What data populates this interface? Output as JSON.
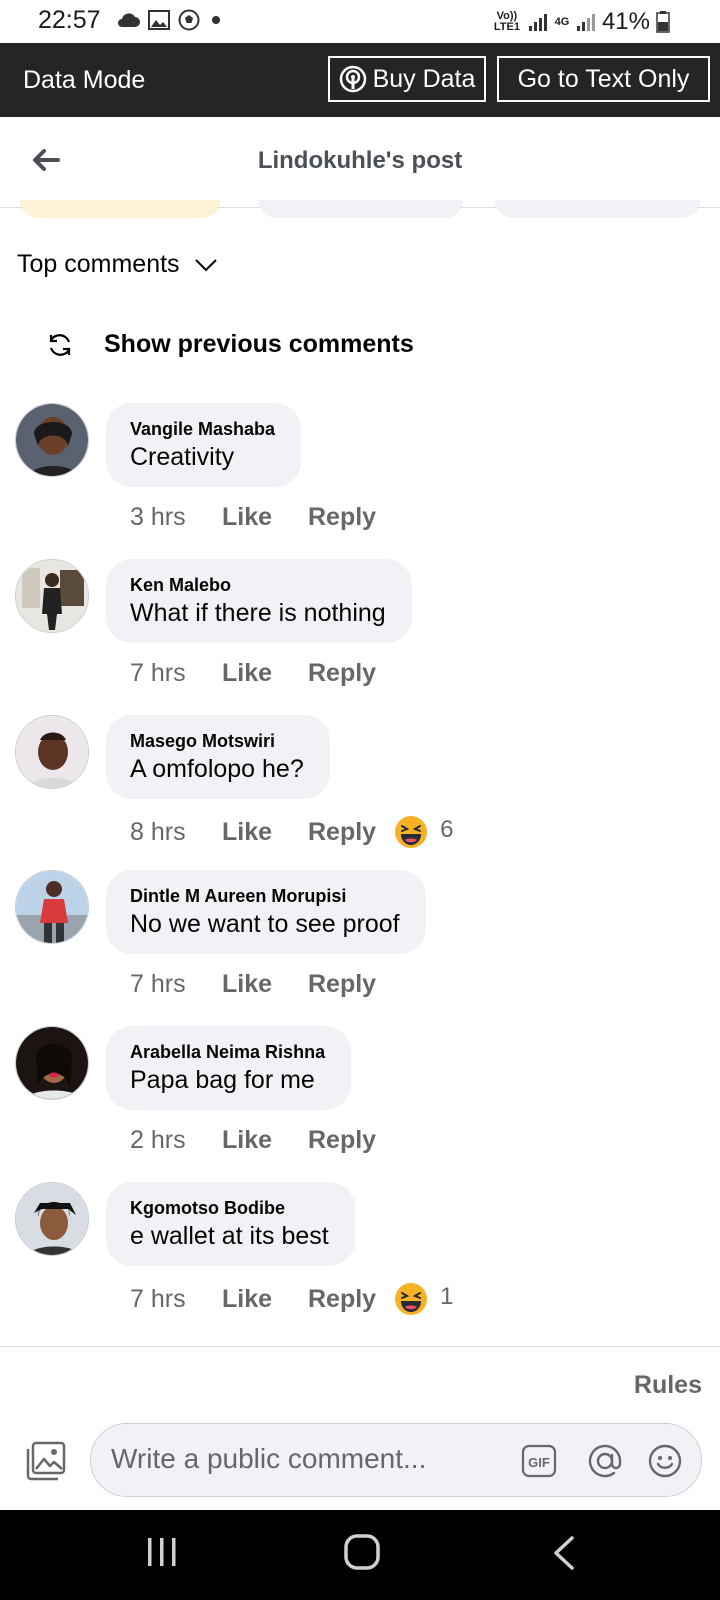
{
  "status_bar": {
    "time": "22:57",
    "net1": "Vo)) LTE1",
    "net2": "4G",
    "battery": "41%",
    "icons": [
      "cloud-icon",
      "image-icon",
      "soccer-ball-icon",
      "dot-icon",
      "signal-icon",
      "battery-icon"
    ]
  },
  "data_bar": {
    "mode_label": "Data Mode",
    "buy_data_label": "Buy Data",
    "text_only_label": "Go to Text Only"
  },
  "header": {
    "title": "Lindokuhle's post"
  },
  "sort": {
    "label": "Top comments"
  },
  "previous": {
    "label": "Show previous comments"
  },
  "comments": [
    {
      "author": "Vangile Mashaba",
      "text": "Creativity",
      "time": "3 hrs",
      "like": "Like",
      "reply": "Reply",
      "reaction_count": ""
    },
    {
      "author": "Ken Malebo",
      "text": "What if there is nothing",
      "time": "7 hrs",
      "like": "Like",
      "reply": "Reply",
      "reaction_count": ""
    },
    {
      "author": "Masego Motswiri",
      "text": "A omfolopo he?",
      "time": "8 hrs",
      "like": "Like",
      "reply": "Reply",
      "reaction_count": "6"
    },
    {
      "author": "Dintle M Aureen Morupisi",
      "text": "No we want to see proof",
      "time": "7 hrs",
      "like": "Like",
      "reply": "Reply",
      "reaction_count": ""
    },
    {
      "author": "Arabella Neima Rishna",
      "text": "Papa bag for me",
      "time": "2 hrs",
      "like": "Like",
      "reply": "Reply",
      "reaction_count": ""
    },
    {
      "author": "Kgomotso Bodibe",
      "text": "e wallet at its best",
      "time": "7 hrs",
      "like": "Like",
      "reply": "Reply",
      "reaction_count": "1"
    }
  ],
  "composer": {
    "rules_label": "Rules",
    "placeholder": "Write a public comment..."
  },
  "colors": {
    "dark_bar": "#242526",
    "bubble": "#f0f2f5",
    "secondary_text": "#65676b",
    "haha_emoji": "#f7b125"
  }
}
